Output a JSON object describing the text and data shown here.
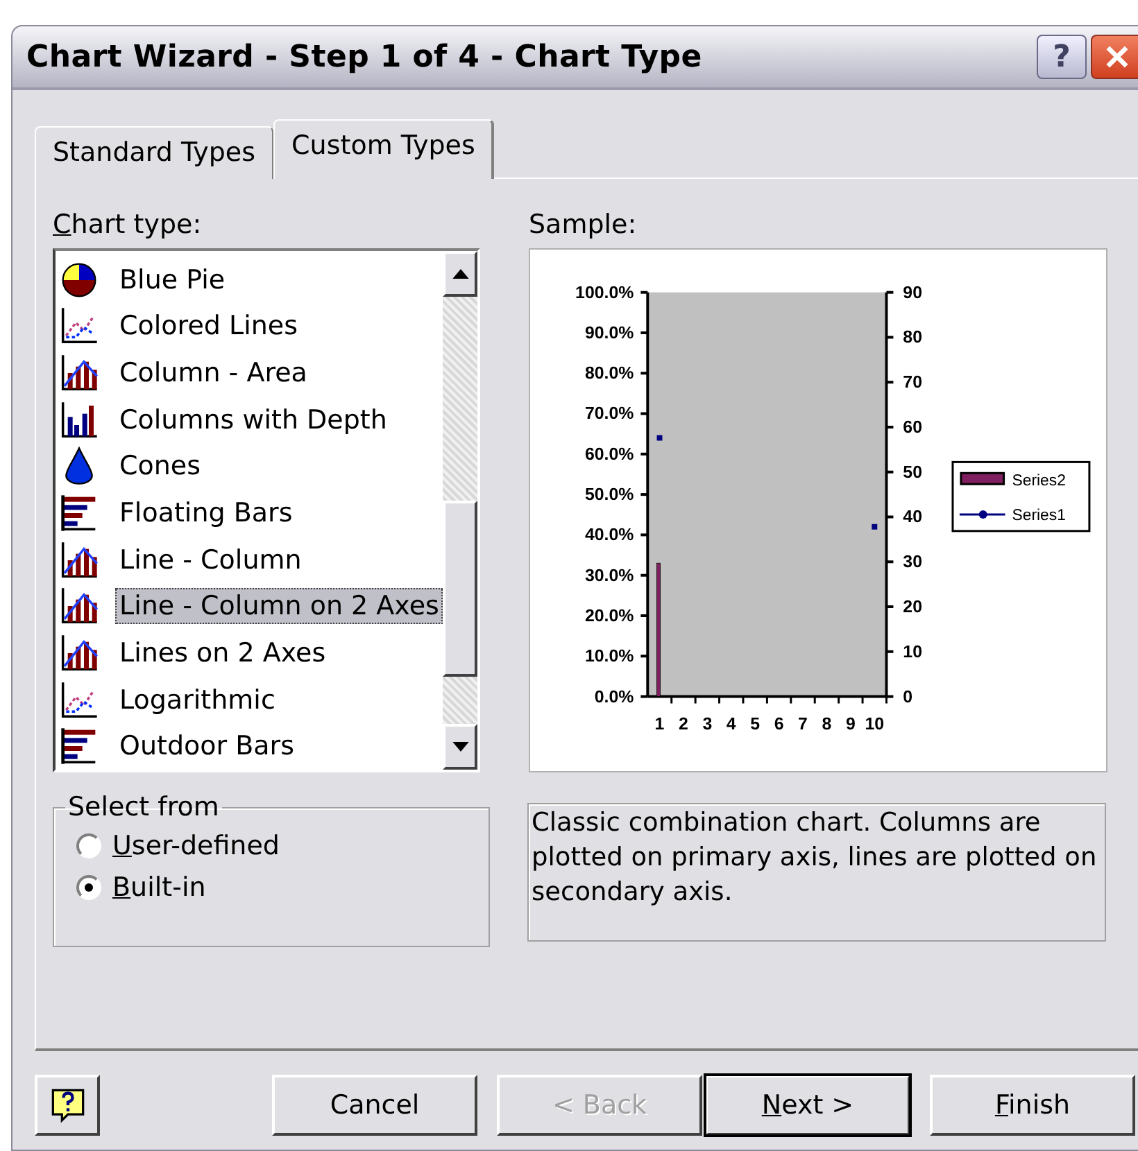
{
  "window": {
    "title": "Chart Wizard - Step 1 of 4 - Chart Type",
    "help_button": "?"
  },
  "tabs": [
    {
      "label": "Standard Types",
      "selected": false
    },
    {
      "label": "Custom Types",
      "selected": true
    }
  ],
  "chart_type": {
    "label": "Chart type:",
    "underline_first": true,
    "items": [
      {
        "label": "Blue Pie",
        "kind": "pie",
        "selected": false
      },
      {
        "label": "Colored Lines",
        "kind": "lines",
        "selected": false
      },
      {
        "label": "Column - Area",
        "kind": "column-line",
        "selected": false
      },
      {
        "label": "Columns with Depth",
        "kind": "columns",
        "selected": false
      },
      {
        "label": "Cones",
        "kind": "cone",
        "selected": false
      },
      {
        "label": "Floating Bars",
        "kind": "bars",
        "selected": false
      },
      {
        "label": "Line - Column",
        "kind": "column-line",
        "selected": false
      },
      {
        "label": "Line - Column on 2 Axes",
        "kind": "column-line",
        "selected": true
      },
      {
        "label": "Lines on 2 Axes",
        "kind": "column-line",
        "selected": false
      },
      {
        "label": "Logarithmic",
        "kind": "lines",
        "selected": false
      },
      {
        "label": "Outdoor Bars",
        "kind": "bars",
        "selected": false
      }
    ]
  },
  "sample": {
    "label": "Sample:",
    "chart_data": {
      "type": "bar",
      "categories": [
        "1",
        "2",
        "3",
        "4",
        "5",
        "6",
        "7",
        "8",
        "9",
        "10"
      ],
      "series": [
        {
          "name": "Series2",
          "type": "bar",
          "color": "#7f1f5f",
          "values": [
            0.33,
            null,
            null,
            null,
            null,
            null,
            null,
            null,
            null,
            null
          ]
        },
        {
          "name": "Series1",
          "type": "line",
          "color": "#000080",
          "values": [
            0.64,
            null,
            null,
            null,
            null,
            null,
            null,
            null,
            null,
            0.42
          ]
        }
      ],
      "ylim": [
        0,
        1
      ],
      "yticks": [
        {
          "value": 0,
          "label": "0.0%"
        },
        {
          "value": 0.1,
          "label": "10.0%"
        },
        {
          "value": 0.2,
          "label": "20.0%"
        },
        {
          "value": 0.3,
          "label": "30.0%"
        },
        {
          "value": 0.4,
          "label": "40.0%"
        },
        {
          "value": 0.5,
          "label": "50.0%"
        },
        {
          "value": 0.6,
          "label": "60.0%"
        },
        {
          "value": 0.7,
          "label": "70.0%"
        },
        {
          "value": 0.8,
          "label": "80.0%"
        },
        {
          "value": 0.9,
          "label": "90.0%"
        },
        {
          "value": 1,
          "label": "100.0%"
        }
      ],
      "legend": "right",
      "y2lim": [
        0,
        90
      ],
      "y2ticks": [
        0,
        10,
        20,
        30,
        40,
        50,
        60,
        70,
        80,
        90
      ]
    }
  },
  "select_from": {
    "title": "Select from",
    "options": [
      {
        "label": "User-defined",
        "selected": false,
        "underline_first": true
      },
      {
        "label": "Built-in",
        "selected": true,
        "underline_first": true
      }
    ]
  },
  "description": "Classic combination chart. Columns are plotted on primary axis, lines are plotted on secondary axis.",
  "buttons": [
    {
      "label": "Cancel",
      "disabled": false,
      "default": false,
      "underline_first": false
    },
    {
      "label": "< Back",
      "disabled": true,
      "default": false,
      "underline_first": false
    },
    {
      "label": "Next >",
      "disabled": false,
      "default": true,
      "underline_first": true
    },
    {
      "label": "Finish",
      "disabled": false,
      "default": false,
      "underline_first": true
    }
  ]
}
